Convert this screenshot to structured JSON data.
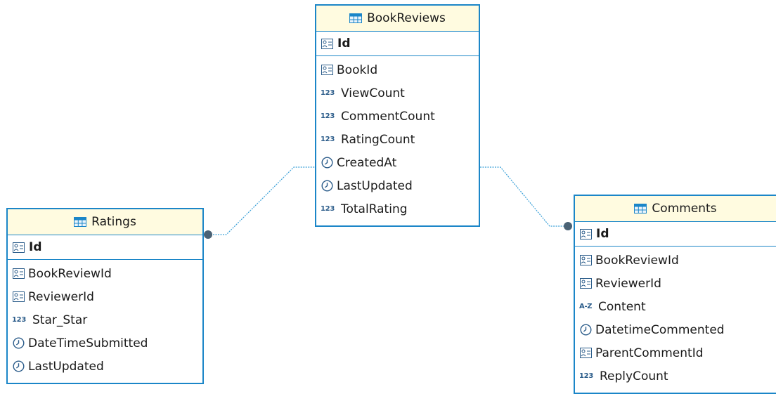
{
  "diagram": {
    "accent_color": "#1b86c8",
    "header_color": "#fffbe0",
    "connector_color": "#3aa0d8",
    "entities": {
      "bookreviews": {
        "title": "BookReviews",
        "title_icon": "table-icon",
        "pk": {
          "name": "Id",
          "icon": "key-icon"
        },
        "columns": [
          {
            "name": "BookId",
            "icon": "key-icon"
          },
          {
            "name": "ViewCount",
            "icon": "numeric-icon",
            "icon_text": "123"
          },
          {
            "name": "CommentCount",
            "icon": "numeric-icon",
            "icon_text": "123"
          },
          {
            "name": "RatingCount",
            "icon": "numeric-icon",
            "icon_text": "123"
          },
          {
            "name": "CreatedAt",
            "icon": "clock-icon"
          },
          {
            "name": "LastUpdated",
            "icon": "clock-icon"
          },
          {
            "name": "TotalRating",
            "icon": "numeric-icon",
            "icon_text": "123"
          }
        ]
      },
      "ratings": {
        "title": "Ratings",
        "title_icon": "table-icon",
        "pk": {
          "name": "Id",
          "icon": "key-icon"
        },
        "columns": [
          {
            "name": "BookReviewId",
            "icon": "key-icon"
          },
          {
            "name": "ReviewerId",
            "icon": "key-icon"
          },
          {
            "name": "Star_Star",
            "icon": "numeric-icon",
            "icon_text": "123"
          },
          {
            "name": "DateTimeSubmitted",
            "icon": "clock-icon"
          },
          {
            "name": "LastUpdated",
            "icon": "clock-icon"
          }
        ]
      },
      "comments": {
        "title": "Comments",
        "title_icon": "table-icon",
        "pk": {
          "name": "Id",
          "icon": "key-icon"
        },
        "columns": [
          {
            "name": "BookReviewId",
            "icon": "key-icon"
          },
          {
            "name": "ReviewerId",
            "icon": "key-icon"
          },
          {
            "name": "Content",
            "icon": "text-icon",
            "icon_text": "A-Z"
          },
          {
            "name": "DatetimeCommented",
            "icon": "clock-icon"
          },
          {
            "name": "ParentCommentId",
            "icon": "key-icon"
          },
          {
            "name": "ReplyCount",
            "icon": "numeric-icon",
            "icon_text": "123"
          }
        ]
      }
    }
  }
}
